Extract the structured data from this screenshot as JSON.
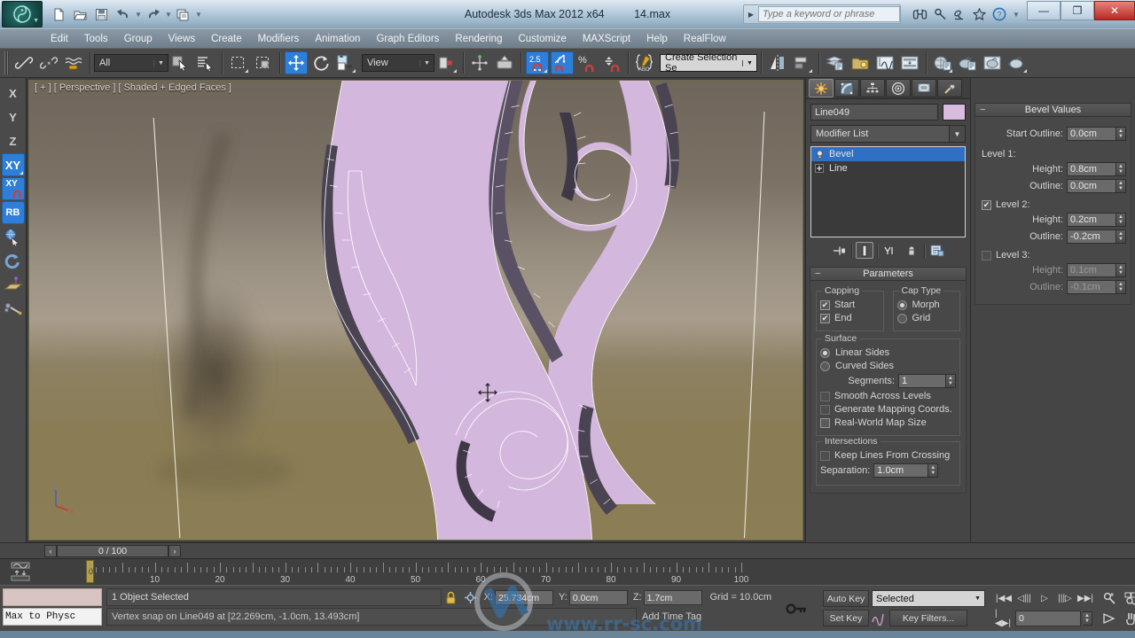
{
  "window": {
    "title": "Autodesk 3ds Max  2012 x64",
    "filename": "14.max",
    "minimize": "—",
    "restore": "❐",
    "close": "✕"
  },
  "search": {
    "placeholder": "Type a keyword or phrase",
    "value": ""
  },
  "quick_access": [
    {
      "name": "new-file",
      "glyph": "□"
    },
    {
      "name": "open-file",
      "glyph": "▷"
    },
    {
      "name": "save-file",
      "glyph": "▤"
    },
    {
      "name": "undo",
      "glyph": "↶"
    },
    {
      "name": "redo",
      "glyph": "↷"
    },
    {
      "name": "set-project-folder",
      "glyph": "❐"
    }
  ],
  "menu": [
    "Edit",
    "Tools",
    "Group",
    "Views",
    "Create",
    "Modifiers",
    "Animation",
    "Graph Editors",
    "Rendering",
    "Customize",
    "MAXScript",
    "Help",
    "RealFlow"
  ],
  "toolbar": {
    "selection_filter": "All",
    "reference_coord": "View",
    "named_selection_set": "Create Selection Se",
    "snap_value": "2.5",
    "percent_symbol": "%",
    "buttons": [
      {
        "name": "select-and-link-button",
        "glyph": "link"
      },
      {
        "name": "unlink-selection-button",
        "glyph": "unlink"
      },
      {
        "name": "bind-to-space-warp-button",
        "glyph": "spacewarp"
      },
      {
        "name": "select-object-button",
        "glyph": "cursor"
      },
      {
        "name": "select-by-name-button",
        "glyph": "byname"
      },
      {
        "name": "rectangular-selection-region-button",
        "glyph": "rect"
      },
      {
        "name": "window-crossing-button",
        "glyph": "crossing"
      },
      {
        "name": "select-and-move-button",
        "glyph": "move",
        "active": true
      },
      {
        "name": "select-and-rotate-button",
        "glyph": "rotate"
      },
      {
        "name": "select-and-scale-button",
        "glyph": "scale"
      },
      {
        "name": "use-center-flyout-button",
        "glyph": "center"
      },
      {
        "name": "select-and-manipulate-button",
        "glyph": "manipulate"
      },
      {
        "name": "snaps-toggle-button",
        "glyph": "snap25",
        "active": true
      },
      {
        "name": "angle-snap-toggle-button",
        "glyph": "anglesnap",
        "active": true
      },
      {
        "name": "percent-snap-toggle-button",
        "glyph": "pctsnap"
      },
      {
        "name": "spinner-snap-toggle-button",
        "glyph": "spinsnap"
      },
      {
        "name": "edit-named-selection-sets-button",
        "glyph": "abc"
      },
      {
        "name": "mirror-button",
        "glyph": "mirror"
      },
      {
        "name": "align-button",
        "glyph": "align"
      },
      {
        "name": "layer-manager-button",
        "glyph": "layers"
      },
      {
        "name": "toggle-scene-explorer-button",
        "glyph": "explorer"
      },
      {
        "name": "curve-editor-button",
        "glyph": "curve"
      },
      {
        "name": "schematic-view-button",
        "glyph": "schematic"
      },
      {
        "name": "material-editor-button",
        "glyph": "material"
      },
      {
        "name": "render-setup-button",
        "glyph": "rendersetup"
      },
      {
        "name": "rendered-frame-window-button",
        "glyph": "renderframe"
      },
      {
        "name": "render-production-button",
        "glyph": "renderprod"
      }
    ]
  },
  "left_toolbar": [
    {
      "name": "axis-constraint-x",
      "label": "X",
      "active": false
    },
    {
      "name": "axis-constraint-y",
      "label": "Y",
      "active": false
    },
    {
      "name": "axis-constraint-z",
      "label": "Z",
      "active": false
    },
    {
      "name": "axis-constraint-xy",
      "label": "XY",
      "active": true
    },
    {
      "name": "snap-to-xy-plane",
      "label": "XY",
      "active": true
    },
    {
      "name": "reference-coordinate-rb",
      "label": "RB",
      "active": true
    },
    {
      "name": "spinner-snap-icon",
      "label": "",
      "active": false
    },
    {
      "name": "auto-grid-icon",
      "label": "",
      "active": false
    },
    {
      "name": "grid-object-icon",
      "label": "",
      "active": false
    },
    {
      "name": "object-paint-icon",
      "label": "",
      "active": false
    }
  ],
  "viewport": {
    "label": "[ + ] [ Perspective ] [ Shaded + Edged Faces ]",
    "axis_x": "x",
    "axis_z": "z",
    "model_color": "#d4b7dd",
    "edge_color": "#ffffff",
    "bg_top": "#6e655a",
    "bg_mid": "#8c8071",
    "bg_bottom": "#8a7d55"
  },
  "command_panel": {
    "tabs": [
      {
        "name": "create-tab",
        "glyph": "create",
        "active": true
      },
      {
        "name": "modify-tab",
        "glyph": "modify",
        "active": false
      },
      {
        "name": "hierarchy-tab",
        "glyph": "hierarchy",
        "active": false
      },
      {
        "name": "motion-tab",
        "glyph": "motion",
        "active": false
      },
      {
        "name": "display-tab",
        "glyph": "display",
        "active": false
      },
      {
        "name": "utilities-tab",
        "glyph": "utilities",
        "active": false
      }
    ],
    "object_name": "Line049",
    "modifier_list_label": "Modifier List",
    "stack": [
      {
        "label": "Bevel",
        "selected": true
      },
      {
        "label": "Line",
        "selected": false
      }
    ],
    "stack_buttons": [
      {
        "name": "pin-stack-button"
      },
      {
        "name": "show-end-result-button",
        "framed": true
      },
      {
        "name": "make-unique-button"
      },
      {
        "name": "remove-modifier-button"
      },
      {
        "name": "configure-modifier-sets-button"
      }
    ],
    "parameters": {
      "title": "Parameters",
      "capping": {
        "label": "Capping",
        "start": {
          "label": "Start",
          "checked": true
        },
        "end": {
          "label": "End",
          "checked": true
        }
      },
      "cap_type": {
        "label": "Cap Type",
        "morph": {
          "label": "Morph",
          "selected": true
        },
        "grid": {
          "label": "Grid",
          "selected": false
        }
      },
      "surface": {
        "label": "Surface",
        "linear_sides": {
          "label": "Linear Sides",
          "selected": true
        },
        "curved_sides": {
          "label": "Curved Sides",
          "selected": false
        },
        "segments_label": "Segments:",
        "segments_value": "1",
        "smooth_across_levels": {
          "label": "Smooth Across Levels",
          "checked": false
        },
        "generate_mapping_coords": {
          "label": "Generate Mapping Coords.",
          "checked": false
        },
        "real_world_map_size": {
          "label": "Real-World Map Size",
          "checked": false
        }
      },
      "intersections": {
        "label": "Intersections",
        "keep_lines": {
          "label": "Keep Lines From Crossing",
          "checked": false
        },
        "separation_label": "Separation:",
        "separation_value": "1.0cm"
      }
    },
    "bevel_values": {
      "title": "Bevel Values",
      "start_outline_label": "Start Outline:",
      "start_outline_value": "0.0cm",
      "level1": {
        "label": "Level 1:",
        "height_label": "Height:",
        "height_value": "0.8cm",
        "outline_label": "Outline:",
        "outline_value": "0.0cm"
      },
      "level2": {
        "label": "Level 2:",
        "checked": true,
        "height_label": "Height:",
        "height_value": "0.2cm",
        "outline_label": "Outline:",
        "outline_value": "-0.2cm"
      },
      "level3": {
        "label": "Level 3:",
        "checked": false,
        "height_label": "Height:",
        "height_value": "0.1cm",
        "outline_label": "Outline:",
        "outline_value": "-0.1cm"
      }
    }
  },
  "timeline": {
    "current_frame": "0 / 100",
    "prev_glyph": "‹",
    "next_glyph": "›",
    "ticks": [
      0,
      10,
      20,
      30,
      40,
      50,
      60,
      70,
      80,
      90,
      100
    ],
    "tick_labels": [
      "0",
      "10",
      "20",
      "30",
      "40",
      "50",
      "60",
      "70",
      "80",
      "90",
      "100"
    ],
    "playhead_frame": "0"
  },
  "statusbar": {
    "mini_listener_value": "",
    "script_label": "Max to Physc",
    "selection_prompt": "1 Object Selected",
    "status_message": "Vertex snap on Line049 at [22.269cm, -1.0cm, 13.493cm]",
    "lock_icon": "lock-selection-icon",
    "coords": [
      {
        "axis": "X:",
        "value": "25.734cm"
      },
      {
        "axis": "Y:",
        "value": "0.0cm"
      },
      {
        "axis": "Z:",
        "value": "1.7cm"
      }
    ],
    "grid_label": "Grid = 10.0cm",
    "time_tag_label": "Add Time Tag"
  },
  "animation": {
    "auto_key": "Auto Key",
    "set_key": "Set Key",
    "key_filters": "Key Filters...",
    "selection_level": "Selected",
    "key_mode_value": "0",
    "playback": [
      {
        "name": "go-to-start-button",
        "glyph": "|◀◀"
      },
      {
        "name": "previous-frame-button",
        "glyph": "◁|||"
      },
      {
        "name": "play-animation-button",
        "glyph": "▷"
      },
      {
        "name": "next-frame-button",
        "glyph": "|||▷"
      },
      {
        "name": "go-to-end-button",
        "glyph": "▶▶|"
      }
    ],
    "viewport_nav": [
      {
        "name": "zoom-button"
      },
      {
        "name": "zoom-all-button"
      },
      {
        "name": "zoom-extents-button"
      },
      {
        "name": "zoom-extents-all-button"
      },
      {
        "name": "field-of-view-button"
      },
      {
        "name": "pan-view-button"
      },
      {
        "name": "orbit-button"
      },
      {
        "name": "maximize-viewport-toggle-button"
      }
    ]
  }
}
